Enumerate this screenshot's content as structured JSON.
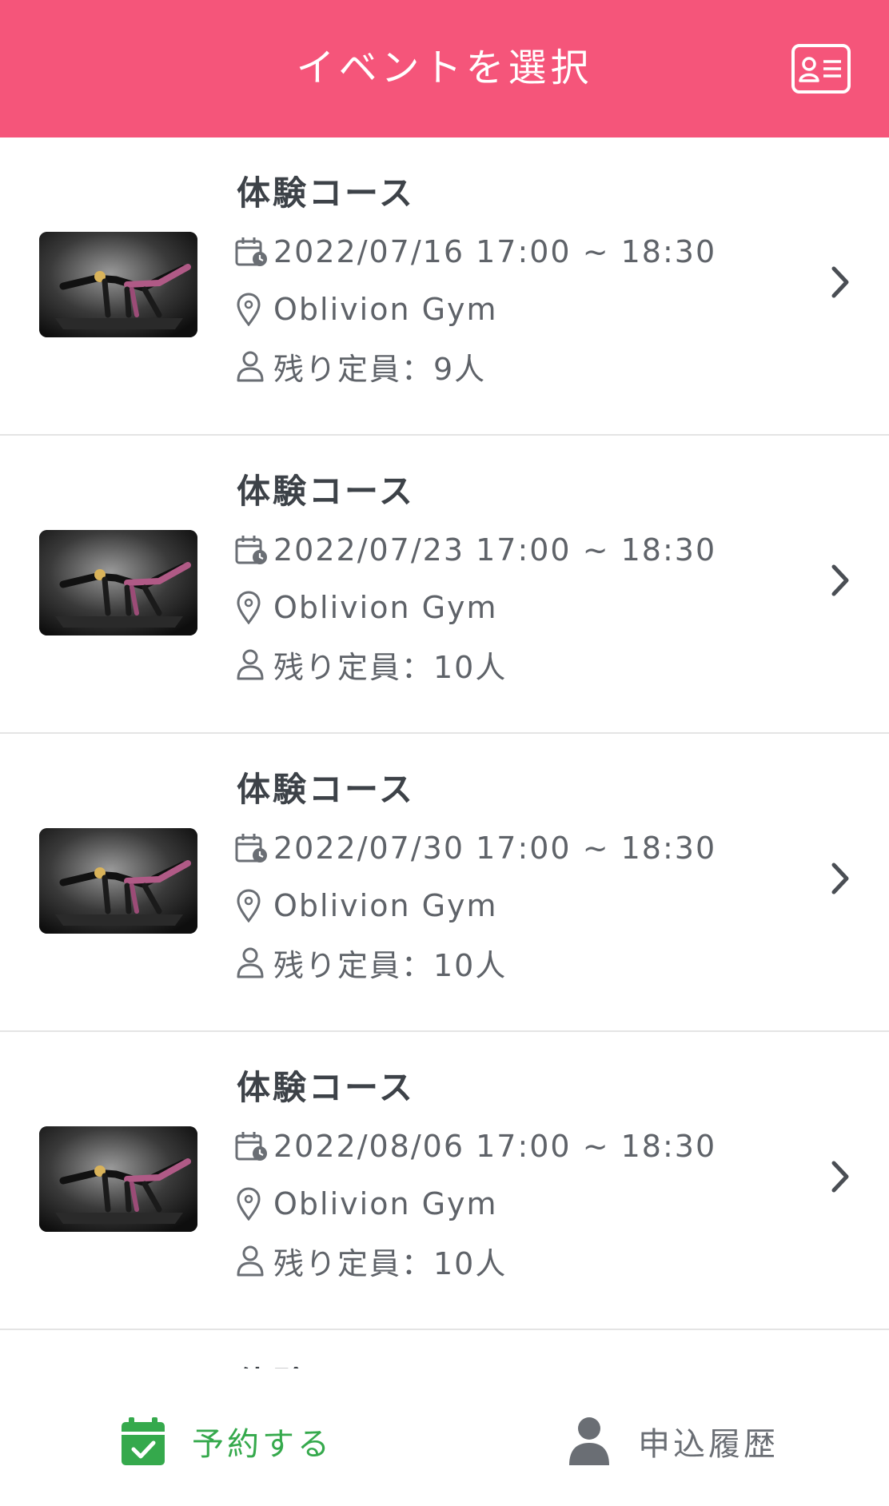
{
  "header": {
    "title": "イベントを選択",
    "background_color": "#f5557a",
    "right_icon": "id-card-icon"
  },
  "events": [
    {
      "title": "体験コース",
      "datetime": "2022/07/16 17:00 ~ 18:30",
      "location": "Oblivion Gym",
      "capacity": "残り定員：9人",
      "thumbnail": "fitness-photo"
    },
    {
      "title": "体験コース",
      "datetime": "2022/07/23 17:00 ~ 18:30",
      "location": "Oblivion Gym",
      "capacity": "残り定員：10人",
      "thumbnail": "fitness-photo"
    },
    {
      "title": "体験コース",
      "datetime": "2022/07/30 17:00 ~ 18:30",
      "location": "Oblivion Gym",
      "capacity": "残り定員：10人",
      "thumbnail": "fitness-photo"
    },
    {
      "title": "体験コース",
      "datetime": "2022/08/06 17:00 ~ 18:30",
      "location": "Oblivion Gym",
      "capacity": "残り定員：10人",
      "thumbnail": "fitness-photo"
    },
    {
      "title": "体験コース"
    }
  ],
  "icons": {
    "date": "calendar-clock-icon",
    "location": "map-pin-icon",
    "capacity": "person-icon",
    "row_action": "chevron-right-icon"
  },
  "bottom_nav": {
    "items": [
      {
        "label": "予約する",
        "icon": "calendar-check-icon",
        "color": "#35a94c",
        "active": true
      },
      {
        "label": "申込履歴",
        "icon": "user-icon",
        "color": "#6a6e74",
        "active": false
      }
    ]
  }
}
